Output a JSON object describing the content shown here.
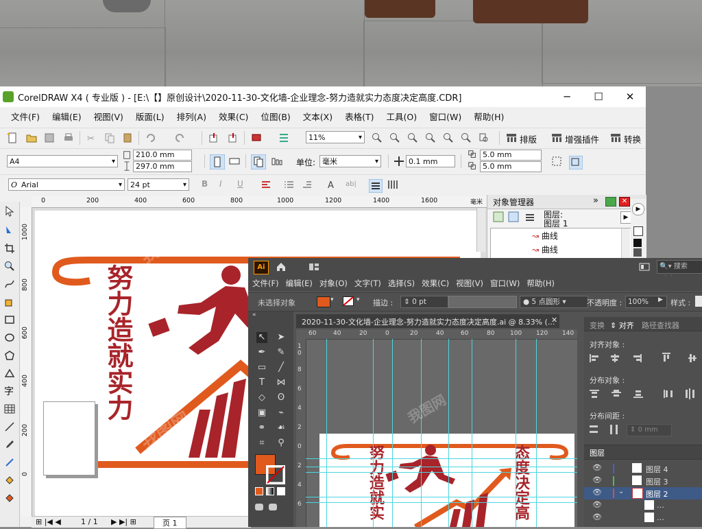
{
  "coreldraw": {
    "title": "CorelDRAW X4 ( 专业版 ) - [E:\\【】原创设计\\2020-11-30-文化墙-企业理念-努力造就实力态度决定高度.CDR]",
    "window_buttons": {
      "minimize": "─",
      "maximize": "☐",
      "close": "✕"
    },
    "menu": [
      "文件(F)",
      "编辑(E)",
      "视图(V)",
      "版面(L)",
      "排列(A)",
      "效果(C)",
      "位图(B)",
      "文本(X)",
      "表格(T)",
      "工具(O)",
      "窗口(W)",
      "帮助(H)"
    ],
    "zoom": "11%",
    "toolbar_actions": [
      "排版",
      "增强插件",
      "转换"
    ],
    "page_size": "A4",
    "width": "210.0 mm",
    "height": "297.0 mm",
    "units_label": "单位:",
    "units": "毫米",
    "nudge": "0.1 mm",
    "dup_x": "5.0 mm",
    "dup_y": "5.0 mm",
    "font": "Arial",
    "font_size": "24 pt",
    "ruler_unit": "毫米",
    "ruler_h_ticks": [
      "0",
      "200",
      "400",
      "600",
      "800",
      "1000",
      "1200",
      "1400",
      "1600"
    ],
    "ruler_v_ticks": [
      "1000",
      "800",
      "600",
      "400",
      "200",
      "0"
    ],
    "object_manager": {
      "title": "对象管理器",
      "layer_label": "图层:",
      "layer_name": "图层 1",
      "items": [
        "曲线",
        "曲线"
      ]
    },
    "status": {
      "page_counter": "1 / 1",
      "page_tab": "页 1"
    },
    "artwork_text": "努力造就实力",
    "colors": {
      "orange": "#e05a1e",
      "red": "#a8242a"
    }
  },
  "illustrator": {
    "logo": "Ai",
    "search_placeholder": "搜索 Adobe",
    "menu": [
      "文件(F)",
      "编辑(E)",
      "对象(O)",
      "文字(T)",
      "选择(S)",
      "效果(C)",
      "视图(V)",
      "窗口(W)",
      "帮助(H)"
    ],
    "control": {
      "no_selection": "未选择对象",
      "stroke_label": "描边 :",
      "stroke_value": "0 pt",
      "brush": "5 点圆形",
      "opacity_label": "不透明度 :",
      "opacity_value": "100%",
      "style_label": "样式 :"
    },
    "doc_tab": "2020-11-30-文化墙-企业理念-努力造就实力态度决定高度.ai @ 8.33% (...",
    "ruler_ticks": [
      "60",
      "40",
      "20",
      "0",
      "20",
      "40",
      "60",
      "80",
      "100",
      "120",
      "140"
    ],
    "ruler_v_ticks": [
      "1",
      "0",
      "8",
      "6",
      "4",
      "2",
      "0",
      "2",
      "4",
      "6"
    ],
    "panel_tabs": [
      "变换",
      "对齐",
      "路径查找器"
    ],
    "align_objects_label": "对齐对象 :",
    "distribute_objects_label": "分布对象 :",
    "distribute_spacing_label": "分布间距 :",
    "spacing_value": "0 mm",
    "layers_title": "图层",
    "layers": [
      "图层 4",
      "图层 3",
      "图层 2",
      "…",
      "…"
    ],
    "artwork_left": "努力造就实",
    "artwork_right": "态度决定高"
  }
}
